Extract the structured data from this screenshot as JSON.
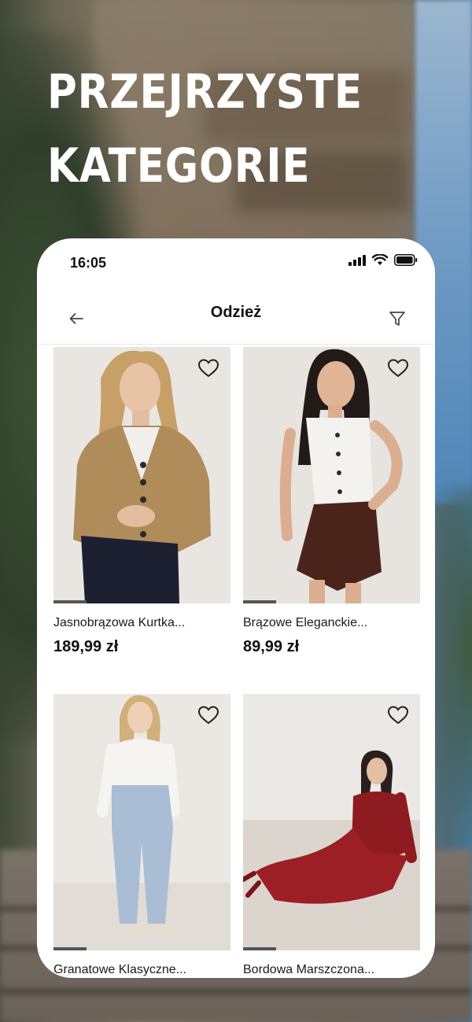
{
  "headline": [
    "PRZEJRZYSTE",
    "KATEGORIE"
  ],
  "phone": {
    "status_time": "16:05",
    "nav_title": "Odzież",
    "products": [
      {
        "name": "Jasnobrązowa Kurtka...",
        "price": "189,99 zł"
      },
      {
        "name": "Brązowe Eleganckie...",
        "price": "89,99 zł"
      },
      {
        "name": "Granatowe Klasyczne...",
        "price": ""
      },
      {
        "name": "Bordowa Marszczona...",
        "price": ""
      }
    ]
  },
  "colors": {
    "card_bg": "#ffffff",
    "text": "#111111",
    "indicator": "#555555"
  },
  "icons": [
    "back-arrow-icon",
    "filter-icon",
    "heart-icon",
    "signal-icon",
    "wifi-icon",
    "battery-icon"
  ]
}
